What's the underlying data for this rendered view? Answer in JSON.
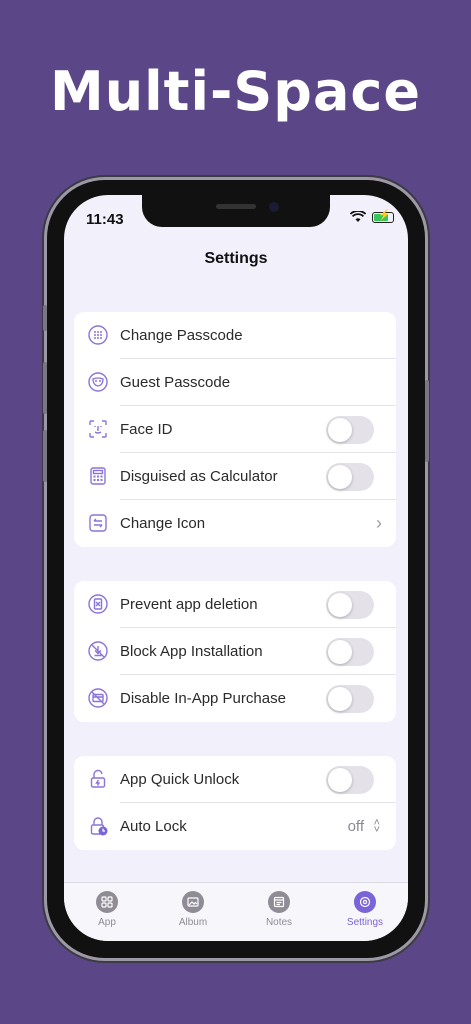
{
  "headline": "Multi-Space",
  "status_bar": {
    "time": "11:43"
  },
  "nav": {
    "title": "Settings"
  },
  "groups": [
    {
      "rows": [
        {
          "icon": "keypad-icon",
          "label": "Change Passcode",
          "accessory": "none"
        },
        {
          "icon": "guest-mask-icon",
          "label": "Guest Passcode",
          "accessory": "none"
        },
        {
          "icon": "face-id-icon",
          "label": "Face ID",
          "accessory": "toggle",
          "on": false
        },
        {
          "icon": "calculator-icon",
          "label": "Disguised as Calculator",
          "accessory": "toggle",
          "on": false
        },
        {
          "icon": "change-icon-icon",
          "label": "Change Icon",
          "accessory": "chevron"
        }
      ]
    },
    {
      "rows": [
        {
          "icon": "prevent-delete-icon",
          "label": "Prevent app deletion",
          "accessory": "toggle",
          "on": false
        },
        {
          "icon": "block-install-icon",
          "label": "Block App Installation",
          "accessory": "toggle",
          "on": false
        },
        {
          "icon": "no-purchase-icon",
          "label": "Disable In-App Purchase",
          "accessory": "toggle",
          "on": false
        }
      ]
    },
    {
      "rows": [
        {
          "icon": "quick-unlock-icon",
          "label": "App Quick Unlock",
          "accessory": "toggle",
          "on": false
        },
        {
          "icon": "auto-lock-icon",
          "label": "Auto Lock",
          "accessory": "value",
          "value": "off"
        }
      ]
    }
  ],
  "tabs": [
    {
      "label": "App",
      "icon": "app-grid-icon",
      "active": false
    },
    {
      "label": "Album",
      "icon": "album-icon",
      "active": false
    },
    {
      "label": "Notes",
      "icon": "notes-icon",
      "active": false
    },
    {
      "label": "Settings",
      "icon": "settings-icon",
      "active": true
    }
  ],
  "colors": {
    "background": "#5b4787",
    "accent": "#7b63d8",
    "icon_purple": "#8b74d9"
  }
}
